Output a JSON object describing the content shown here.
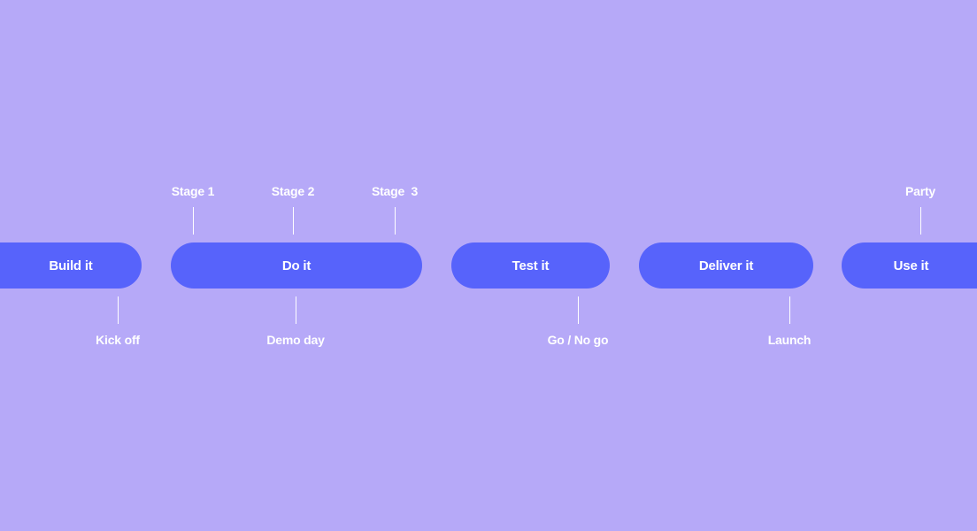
{
  "colors": {
    "background": "#b6a9f8",
    "phase_pill": "#5763fb",
    "text": "#ffffff"
  },
  "phases": [
    {
      "label": "Build it"
    },
    {
      "label": "Do it"
    },
    {
      "label": "Test it"
    },
    {
      "label": "Deliver it"
    },
    {
      "label": "Use it"
    }
  ],
  "milestones_above": [
    {
      "label": "Stage 1"
    },
    {
      "label": "Stage 2"
    },
    {
      "label": "Stage  3"
    },
    {
      "label": "Party"
    }
  ],
  "milestones_below": [
    {
      "label": "Kick off"
    },
    {
      "label": "Demo day"
    },
    {
      "label": "Go / No go"
    },
    {
      "label": "Launch"
    }
  ]
}
